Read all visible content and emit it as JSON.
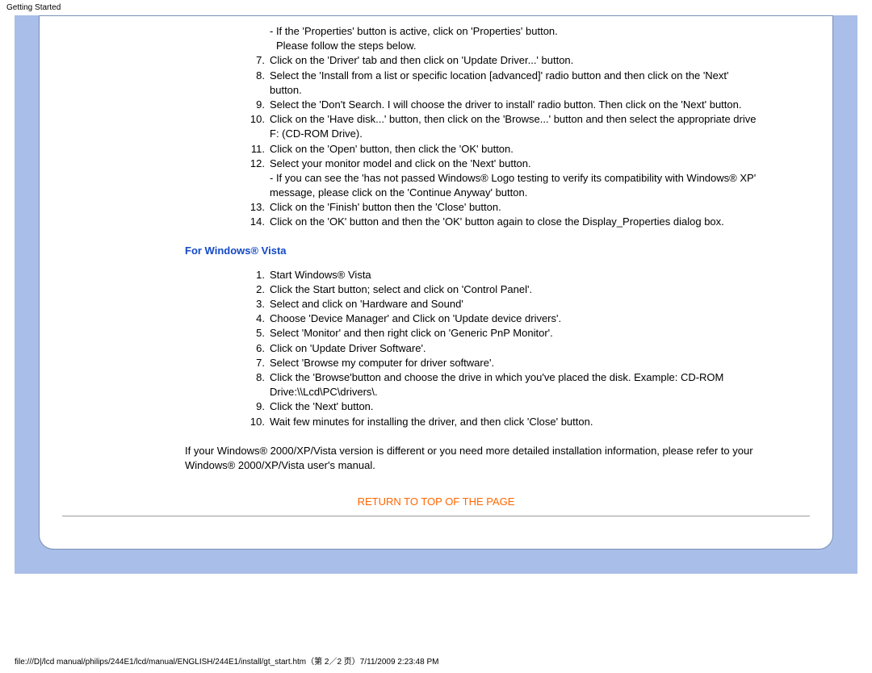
{
  "header": {
    "label": "Getting Started"
  },
  "xp": {
    "dash1": "- If the 'Properties' button is active, click on 'Properties' button.",
    "dash1b": "Please follow the steps below.",
    "items": [
      {
        "n": "7.",
        "t": "Click on the 'Driver' tab and then click on 'Update Driver...' button."
      },
      {
        "n": "8.",
        "t": "Select the 'Install from a list or specific location [advanced]' radio button and then click on the 'Next' button."
      },
      {
        "n": "9.",
        "t": "Select the 'Don't Search. I will choose the driver to install' radio button. Then click on the 'Next' button."
      },
      {
        "n": "10.",
        "t": "Click on the 'Have disk...' button, then click on the 'Browse...' button and then select the appropriate drive F: (CD-ROM Drive)."
      },
      {
        "n": "11.",
        "t": "Click on the 'Open' button, then click the 'OK' button."
      },
      {
        "n": "12.",
        "t": "Select your monitor model and click on the 'Next' button."
      }
    ],
    "dash2": "- If you can see the 'has not passed Windows® Logo testing to verify its compatibility with Windows® XP' message, please click on the 'Continue Anyway' button.",
    "items2": [
      {
        "n": "13.",
        "t": "Click on the 'Finish' button then the 'Close' button."
      },
      {
        "n": "14.",
        "t": "Click on the 'OK' button and then the 'OK' button again to close the Display_Properties dialog box."
      }
    ]
  },
  "vista": {
    "title": "For Windows® Vista",
    "items": [
      {
        "n": "1.",
        "t": "Start Windows® Vista"
      },
      {
        "n": "2.",
        "t": "Click the Start button; select and click on 'Control Panel'."
      },
      {
        "n": "3.",
        "t": "Select and click on 'Hardware and Sound'"
      },
      {
        "n": "4.",
        "t": "Choose 'Device Manager' and Click on 'Update device drivers'."
      },
      {
        "n": "5.",
        "t": "Select 'Monitor' and then right click on 'Generic PnP Monitor'."
      },
      {
        "n": "6.",
        "t": "Click on 'Update Driver Software'."
      },
      {
        "n": "7.",
        "t": "Select 'Browse my computer for driver software'."
      },
      {
        "n": "8.",
        "t": "Click the 'Browse'button and choose the drive in which you've placed the disk. Example: CD-ROM Drive:\\\\Lcd\\PC\\drivers\\."
      },
      {
        "n": "9.",
        "t": "Click the 'Next' button."
      },
      {
        "n": "10.",
        "t": "Wait few minutes for installing the driver, and then click 'Close' button."
      }
    ]
  },
  "footer": {
    "note": "If your Windows® 2000/XP/Vista version is different or you need more detailed installation information, please refer to your Windows® 2000/XP/Vista user's manual.",
    "return": "RETURN TO TOP OF THE PAGE"
  },
  "path": "file:///D|/lcd manual/philips/244E1/lcd/manual/ENGLISH/244E1/install/gt_start.htm（第 2／2 页）7/11/2009 2:23:48 PM"
}
